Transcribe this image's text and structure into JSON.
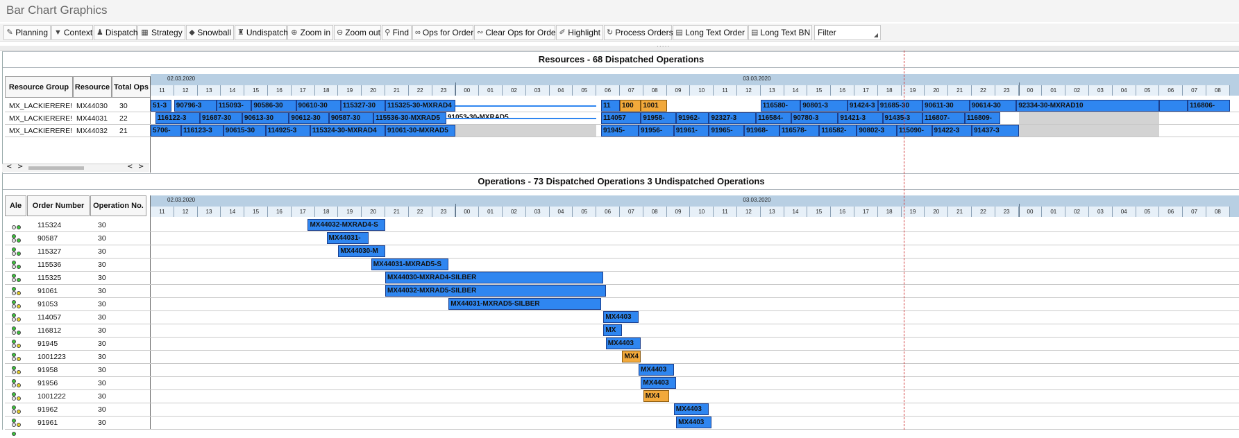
{
  "window": {
    "title": "Bar Chart Graphics"
  },
  "toolbar": {
    "buttons": [
      {
        "label": "Planning",
        "icon": "pencil-icon"
      },
      {
        "label": "Context",
        "icon": "filter-icon"
      },
      {
        "label": "Dispatch",
        "icon": "dispatch-icon"
      },
      {
        "label": "Strategy",
        "icon": "strategy-icon"
      },
      {
        "label": "Snowball",
        "icon": "snowball-icon"
      },
      {
        "label": "Undispatch",
        "icon": "undispatch-icon"
      },
      {
        "label": "Zoom in",
        "icon": "zoom-in-icon"
      },
      {
        "label": "Zoom out",
        "icon": "zoom-out-icon"
      },
      {
        "label": "Find",
        "icon": "binoculars-icon"
      },
      {
        "label": "Ops for Order",
        "icon": "link-icon"
      },
      {
        "label": "Clear Ops for Order",
        "icon": "unlink-icon"
      },
      {
        "label": "Highlight",
        "icon": "highlight-icon"
      },
      {
        "label": "Process Orders",
        "icon": "process-icon"
      },
      {
        "label": "Long Text Order",
        "icon": "document-icon"
      },
      {
        "label": "Long Text BN",
        "icon": "document-icon"
      }
    ],
    "filter": {
      "label": "Filter"
    }
  },
  "resources": {
    "title": "Resources -  68  Dispatched Operations",
    "columns": [
      "Resource Group",
      "Resource",
      "Total Ops"
    ],
    "rows": [
      {
        "group": "MX_LACKIERERE!",
        "resource": "MX44030",
        "total": "30"
      },
      {
        "group": "MX_LACKIERERE!",
        "resource": "MX44031",
        "total": "22"
      },
      {
        "group": "MX_LACKIERERE!",
        "resource": "MX44032",
        "total": "21"
      }
    ],
    "scroll_left": "<",
    "scroll_right": ">"
  },
  "timeline": {
    "day1": "02.03.2020",
    "day2": "03.03.2020",
    "hours": [
      "11",
      "12",
      "13",
      "14",
      "15",
      "16",
      "17",
      "18",
      "19",
      "20",
      "21",
      "22",
      "23",
      "00",
      "01",
      "02",
      "03",
      "04",
      "05",
      "06",
      "07",
      "08",
      "09",
      "10",
      "11",
      "12",
      "13",
      "14",
      "15",
      "16",
      "17",
      "18",
      "19",
      "20",
      "21",
      "22",
      "23",
      "00",
      "01",
      "02",
      "03",
      "04",
      "05",
      "06",
      "07",
      "08"
    ]
  },
  "resource_bars": [
    [
      {
        "text": "51-3",
        "start": 0,
        "end": 0.9
      },
      {
        "text": "90796-3",
        "start": 1.0,
        "end": 2.8
      },
      {
        "text": "115093-",
        "start": 2.8,
        "end": 4.3
      },
      {
        "text": "90586-30",
        "start": 4.3,
        "end": 6.2
      },
      {
        "text": "90610-30",
        "start": 6.2,
        "end": 8.1
      },
      {
        "text": "115327-30",
        "start": 8.1,
        "end": 10.0
      },
      {
        "text": "115325-30-MXRAD4",
        "start": 10.0,
        "end": 13.0
      },
      {
        "text": "",
        "start": 13.0,
        "end": 19.0,
        "kind": "line"
      },
      {
        "text": "11",
        "start": 19.2,
        "end": 20.0
      },
      {
        "text": "100",
        "start": 20.0,
        "end": 20.9,
        "kind": "orange"
      },
      {
        "text": "1001",
        "start": 20.9,
        "end": 22.0,
        "kind": "orange"
      },
      {
        "text": "116580-",
        "start": 26.0,
        "end": 27.7
      },
      {
        "text": "90801-3",
        "start": 27.7,
        "end": 29.7
      },
      {
        "text": "91424-3",
        "start": 29.7,
        "end": 31.0
      },
      {
        "text": "91685-30",
        "start": 31.0,
        "end": 32.9
      },
      {
        "text": "90611-30",
        "start": 32.9,
        "end": 34.9
      },
      {
        "text": "90614-30",
        "start": 34.9,
        "end": 36.9
      },
      {
        "text": "92334-30-MXRAD10",
        "start": 36.9,
        "end": 43.0
      },
      {
        "text": "",
        "start": 43.0,
        "end": 44.2
      },
      {
        "text": "116806-",
        "start": 44.2,
        "end": 46.0
      }
    ],
    [
      {
        "text": "116122-3",
        "start": 0.2,
        "end": 2.1
      },
      {
        "text": "91687-30",
        "start": 2.1,
        "end": 3.9
      },
      {
        "text": "90613-30",
        "start": 3.9,
        "end": 5.9
      },
      {
        "text": "90612-30",
        "start": 5.9,
        "end": 7.6
      },
      {
        "text": "90587-30",
        "start": 7.6,
        "end": 9.5
      },
      {
        "text": "115536-30-MXRAD5",
        "start": 9.5,
        "end": 12.6
      },
      {
        "text": "91053-30-MXRAD5",
        "start": 12.6,
        "end": 19.0,
        "kind": "line"
      },
      {
        "text": "114057",
        "start": 19.2,
        "end": 20.9
      },
      {
        "text": "91958-",
        "start": 20.9,
        "end": 22.4
      },
      {
        "text": "91962-",
        "start": 22.4,
        "end": 23.8
      },
      {
        "text": "92327-3",
        "start": 23.8,
        "end": 25.8
      },
      {
        "text": "116584-",
        "start": 25.8,
        "end": 27.3
      },
      {
        "text": "90780-3",
        "start": 27.3,
        "end": 29.3
      },
      {
        "text": "91421-3",
        "start": 29.3,
        "end": 31.2
      },
      {
        "text": "91435-3",
        "start": 31.2,
        "end": 32.9
      },
      {
        "text": "116807-",
        "start": 32.9,
        "end": 34.7
      },
      {
        "text": "116809-",
        "start": 34.7,
        "end": 36.2
      },
      {
        "text": "",
        "start": 37.0,
        "end": 43.0,
        "kind": "gray"
      }
    ],
    [
      {
        "text": "5706-",
        "start": 0,
        "end": 1.3
      },
      {
        "text": "116123-3",
        "start": 1.3,
        "end": 3.1
      },
      {
        "text": "90615-30",
        "start": 3.1,
        "end": 4.9
      },
      {
        "text": "114925-3",
        "start": 4.9,
        "end": 6.8
      },
      {
        "text": "115324-30-MXRAD4",
        "start": 6.8,
        "end": 10.0
      },
      {
        "text": "91061-30-MXRAD5",
        "start": 10.0,
        "end": 13.0
      },
      {
        "text": "",
        "start": 13.0,
        "end": 19.0,
        "kind": "gray"
      },
      {
        "text": "91945-",
        "start": 19.2,
        "end": 20.8
      },
      {
        "text": "91956-",
        "start": 20.8,
        "end": 22.3
      },
      {
        "text": "91961-",
        "start": 22.3,
        "end": 23.8
      },
      {
        "text": "91965-",
        "start": 23.8,
        "end": 25.3
      },
      {
        "text": "91968-",
        "start": 25.3,
        "end": 26.8
      },
      {
        "text": "116578-",
        "start": 26.8,
        "end": 28.5
      },
      {
        "text": "116582-",
        "start": 28.5,
        "end": 30.1
      },
      {
        "text": "90802-3",
        "start": 30.1,
        "end": 31.8
      },
      {
        "text": "115090-",
        "start": 31.8,
        "end": 33.3
      },
      {
        "text": "91422-3",
        "start": 33.3,
        "end": 35.0
      },
      {
        "text": "91437-3",
        "start": 35.0,
        "end": 37.0
      },
      {
        "text": "",
        "start": 37.0,
        "end": 43.0,
        "kind": "gray"
      }
    ]
  ],
  "operations": {
    "title": "Operations -  73  Dispatched Operations  3  Undispatched Operations",
    "columns": [
      "Ale",
      "Order Number",
      "Operation No."
    ],
    "rows": [
      {
        "order": "115324",
        "op": "30",
        "ale": "green",
        "bar": {
          "text": "MX44032-MXRAD4-S",
          "start": 6.7,
          "end": 10.0
        }
      },
      {
        "order": "90587",
        "op": "30",
        "ale": "green",
        "bar": {
          "text": "MX44031-",
          "start": 7.5,
          "end": 9.3
        }
      },
      {
        "order": "115327",
        "op": "30",
        "ale": "green",
        "bar": {
          "text": "MX44030-M",
          "start": 8.0,
          "end": 10.0
        }
      },
      {
        "order": "115536",
        "op": "30",
        "ale": "green",
        "bar": {
          "text": "MX44031-MXRAD5-S",
          "start": 9.4,
          "end": 12.7
        }
      },
      {
        "order": "115325",
        "op": "30",
        "ale": "green",
        "bar": {
          "text": "MX44030-MXRAD4-SILBER",
          "start": 10.0,
          "end": 19.3
        }
      },
      {
        "order": "91061",
        "op": "30",
        "ale": "yellow",
        "bar": {
          "text": "MX44032-MXRAD5-SILBER",
          "start": 10.0,
          "end": 19.4
        }
      },
      {
        "order": "91053",
        "op": "30",
        "ale": "yellow",
        "bar": {
          "text": "MX44031-MXRAD5-SILBER",
          "start": 12.7,
          "end": 19.2
        }
      },
      {
        "order": "114057",
        "op": "30",
        "ale": "yellow",
        "bar": {
          "text": "MX4403",
          "start": 19.3,
          "end": 20.8
        }
      },
      {
        "order": "116812",
        "op": "30",
        "ale": "green",
        "bar": {
          "text": "MX",
          "start": 19.3,
          "end": 20.1
        }
      },
      {
        "order": "91945",
        "op": "30",
        "ale": "yellow",
        "bar": {
          "text": "MX4403",
          "start": 19.4,
          "end": 20.9
        }
      },
      {
        "order": "1001223",
        "op": "30",
        "ale": "yellow",
        "bar": {
          "text": "MX4",
          "start": 20.1,
          "end": 20.9,
          "kind": "orange"
        }
      },
      {
        "order": "91958",
        "op": "30",
        "ale": "yellow",
        "bar": {
          "text": "MX4403",
          "start": 20.8,
          "end": 22.3
        }
      },
      {
        "order": "91956",
        "op": "30",
        "ale": "yellow",
        "bar": {
          "text": "MX4403",
          "start": 20.9,
          "end": 22.4
        }
      },
      {
        "order": "1001222",
        "op": "30",
        "ale": "yellow",
        "bar": {
          "text": "MX4",
          "start": 21.0,
          "end": 22.1,
          "kind": "orange"
        }
      },
      {
        "order": "91962",
        "op": "30",
        "ale": "yellow",
        "bar": {
          "text": "MX4403",
          "start": 22.3,
          "end": 23.8
        }
      },
      {
        "order": "91961",
        "op": "30",
        "ale": "yellow",
        "bar": {
          "text": "MX4403",
          "start": 22.4,
          "end": 23.9
        }
      }
    ]
  },
  "colors": {
    "bar_blue": "#2f86f0",
    "bar_orange": "#f2a93b",
    "ale_green": "#3cc43c",
    "ale_yellow": "#e6d02a"
  }
}
